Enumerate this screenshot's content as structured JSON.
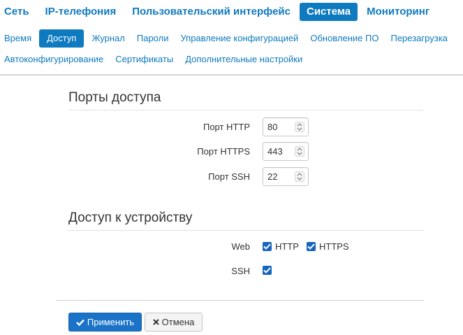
{
  "topnav": {
    "tabs": [
      {
        "label": "Сеть",
        "active": false
      },
      {
        "label": "IP-телефония",
        "active": false
      },
      {
        "label": "Пользовательский интерфейс",
        "active": false
      },
      {
        "label": "Система",
        "active": true
      },
      {
        "label": "Мониторинг",
        "active": false
      }
    ]
  },
  "subnav": {
    "items": [
      {
        "label": "Время",
        "active": false
      },
      {
        "label": "Доступ",
        "active": true
      },
      {
        "label": "Журнал",
        "active": false
      },
      {
        "label": "Пароли",
        "active": false
      },
      {
        "label": "Управление конфигурацией",
        "active": false
      },
      {
        "label": "Обновление ПО",
        "active": false
      },
      {
        "label": "Перезагрузка",
        "active": false
      },
      {
        "label": "Автоконфигурирование",
        "active": false
      },
      {
        "label": "Сертификаты",
        "active": false
      },
      {
        "label": "Дополнительные настройки",
        "active": false
      }
    ]
  },
  "ports": {
    "title": "Порты доступа",
    "http_label": "Порт HTTP",
    "http_value": "80",
    "https_label": "Порт HTTPS",
    "https_value": "443",
    "ssh_label": "Порт SSH",
    "ssh_value": "22"
  },
  "access": {
    "title": "Доступ к устройству",
    "web_label": "Web",
    "http_cb_label": "HTTP",
    "http_checked": true,
    "https_cb_label": "HTTPS",
    "https_checked": true,
    "ssh_label": "SSH",
    "ssh_checked": true
  },
  "buttons": {
    "apply": "Применить",
    "cancel": "Отмена"
  },
  "colors": {
    "accent": "#0e7ac0",
    "checkbox": "#1565c0",
    "primary_button": "#1a73c8"
  },
  "icons": {
    "apply": "check-icon",
    "cancel": "close-icon",
    "spinner": "spinner-arrows-icon"
  }
}
